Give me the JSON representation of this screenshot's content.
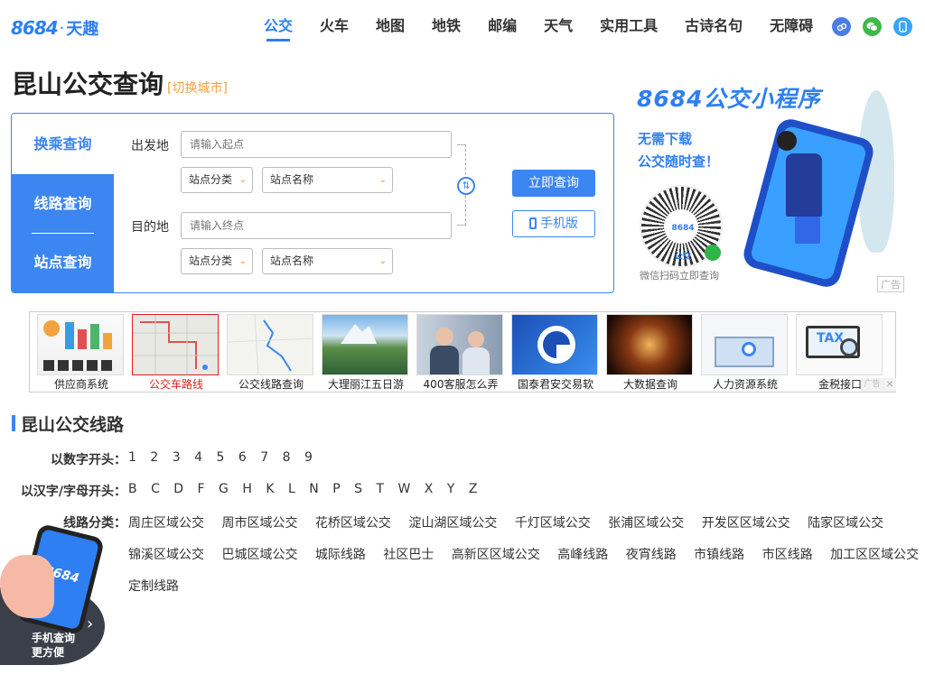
{
  "header": {
    "logo_num": "8684",
    "logo_dot": "·",
    "logo_cn": "天趣",
    "nav": [
      "公交",
      "火车",
      "地图",
      "地铁",
      "邮编",
      "天气",
      "实用工具",
      "古诗名句",
      "无障碍"
    ],
    "nav_active": "公交",
    "icons": [
      "mini-program-icon",
      "wechat-icon",
      "mobile-icon"
    ]
  },
  "page": {
    "title": "昆山公交查询",
    "switch_city": "[切换城市]"
  },
  "query": {
    "tabs": [
      "换乘查询",
      "线路查询",
      "站点查询"
    ],
    "from_label": "出发地",
    "from_placeholder": "请输入起点",
    "to_label": "目的地",
    "to_placeholder": "请输入终点",
    "category_select": "站点分类",
    "name_select": "站点名称",
    "submit": "立即查询",
    "mobile": "手机版"
  },
  "ad_right": {
    "title": "8684公交小程序",
    "sub1": "无需下载",
    "sub2": "公交随时查！",
    "qr_label": "8684公交",
    "caption": "微信扫码立即查询",
    "ad_tag": "广告"
  },
  "strip": {
    "items": [
      "供应商系统",
      "公交车路线",
      "公交线路查询",
      "大理丽江五日游",
      "400客服怎么弄",
      "国泰君安交易软",
      "大数据查询",
      "人力资源系统",
      "金税接口"
    ],
    "selected": "公交车路线",
    "ad_tag": "广告",
    "close": "✕"
  },
  "lines": {
    "section_title": "昆山公交线路",
    "num_label": "以数字开头：",
    "nums": [
      "1",
      "2",
      "3",
      "4",
      "5",
      "6",
      "7",
      "8",
      "9"
    ],
    "letter_label": "以汉字/字母开头：",
    "letters": [
      "B",
      "C",
      "D",
      "F",
      "G",
      "H",
      "K",
      "L",
      "N",
      "P",
      "S",
      "T",
      "W",
      "X",
      "Y",
      "Z"
    ],
    "cat_label": "线路分类：",
    "cats_row1": [
      "周庄区域公交",
      "周市区域公交",
      "花桥区域公交",
      "淀山湖区域公交",
      "千灯区域公交",
      "张浦区域公交",
      "开发区区域公交",
      "陆家区域公交"
    ],
    "cats_row2": [
      "锦溪区域公交",
      "巴城区域公交",
      "城际线路",
      "社区巴士",
      "高新区区域公交",
      "高峰线路",
      "夜宵线路",
      "市镇线路",
      "市区线路",
      "加工区区域公交"
    ],
    "cats_row3": [
      "定制线路"
    ]
  },
  "float_promo": {
    "brand": "8684",
    "line1": "手机查询",
    "line2": "更方便"
  },
  "colors": {
    "accent": "#3b86f0",
    "brand": "#2e7ff2",
    "highlight": "#f5a04a",
    "selected_red": "#e02020"
  }
}
